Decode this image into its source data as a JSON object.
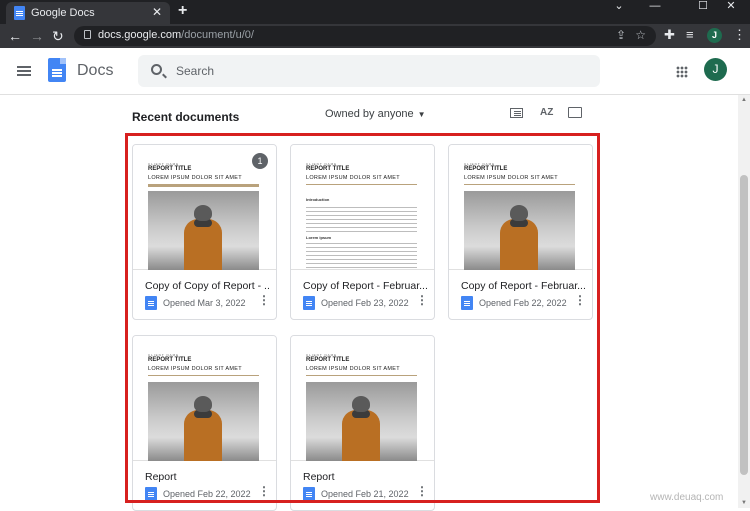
{
  "browser": {
    "tab_title": "Google Docs",
    "tab_close": "✕",
    "new_tab": "+",
    "url_host": "docs.google.com",
    "url_path": "/document/u/0/",
    "profile_initial": "J",
    "window_controls": {
      "chevron": "⌄",
      "minimize": "—",
      "maximize": "☐",
      "close": "✕"
    }
  },
  "header": {
    "app_name": "Docs",
    "search_placeholder": "Search",
    "user_initial": "J"
  },
  "toolbar": {
    "section_title": "Recent documents",
    "owner_filter": "Owned by anyone",
    "sort_label": "AZ"
  },
  "documents": [
    {
      "title": "Copy of Copy of Report - ...",
      "opened": "Opened Mar 3, 2022",
      "badge": "1",
      "thumb": {
        "small": "CLIENT NAME",
        "title": "REPORT TITLE",
        "subtitle": "LOREM IPSUM DOLOR SIT AMET"
      }
    },
    {
      "title": "Copy of Report - Februar...",
      "opened": "Opened Feb 23, 2022",
      "thumb": {
        "small": "CLIENT NAME",
        "title": "REPORT TITLE",
        "subtitle": "LOREM IPSUM DOLOR SIT AMET",
        "heading": "Introduction",
        "heading2": "Lorem ipsum"
      }
    },
    {
      "title": "Copy of Report - Februar...",
      "opened": "Opened Feb 22, 2022",
      "thumb": {
        "small": "CLIENT NAME",
        "title": "REPORT TITLE",
        "subtitle": "LOREM IPSUM DOLOR SIT AMET"
      }
    },
    {
      "title": "Report",
      "opened": "Opened Feb 22, 2022",
      "thumb": {
        "small": "CLIENT NAME",
        "title": "REPORT TITLE",
        "subtitle": "LOREM IPSUM DOLOR SIT AMET"
      }
    },
    {
      "title": "Report",
      "opened": "Opened Feb 21, 2022",
      "thumb": {
        "small": "CLIENT NAME",
        "title": "REPORT TITLE",
        "subtitle": "LOREM IPSUM DOLOR SIT AMET"
      }
    }
  ],
  "watermark": "www.deuaq.com",
  "colors": {
    "docs_blue": "#4285f4",
    "avatar_green": "#1e6b4f",
    "highlight_red": "#d7201f",
    "report_rule": "#b9a27c"
  }
}
